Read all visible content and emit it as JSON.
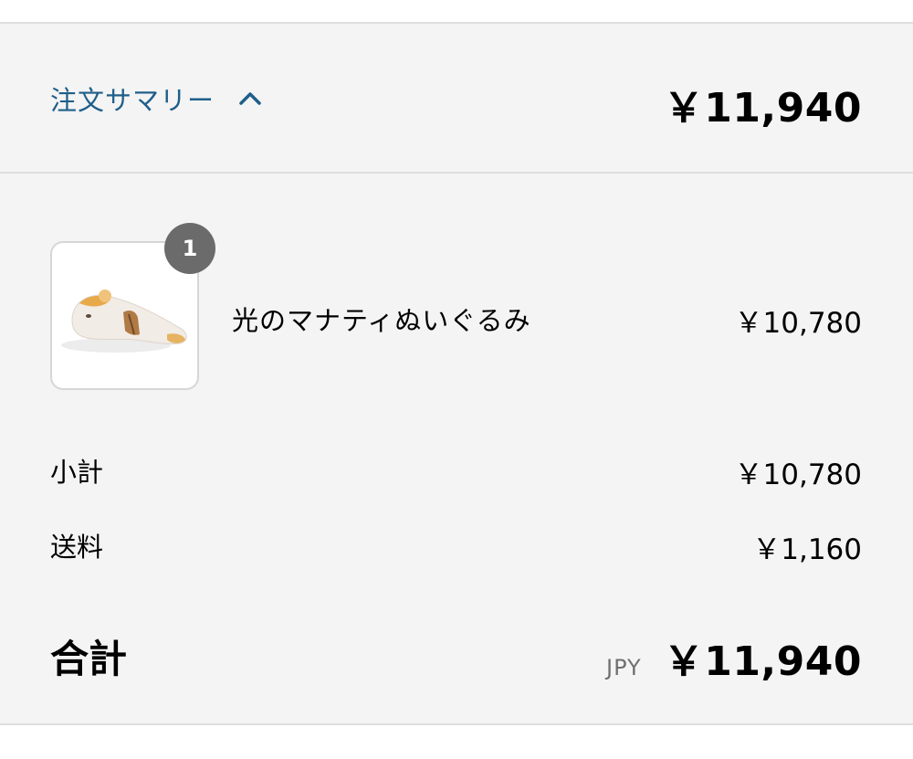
{
  "summary": {
    "toggle_label": "注文サマリー",
    "toggle_icon": "chevron-up-icon",
    "header_total": "￥11,940",
    "accent_color": "#1f5f8a"
  },
  "line_item": {
    "name": "光のマナティぬいぐるみ",
    "price": "￥10,780",
    "quantity": "1",
    "image_icon": "manatee-plush-image"
  },
  "breakdown": {
    "subtotal_label": "小計",
    "subtotal_value": "￥10,780",
    "shipping_label": "送料",
    "shipping_value": "￥1,160"
  },
  "total": {
    "label": "合計",
    "currency": "JPY",
    "value": "￥11,940"
  }
}
